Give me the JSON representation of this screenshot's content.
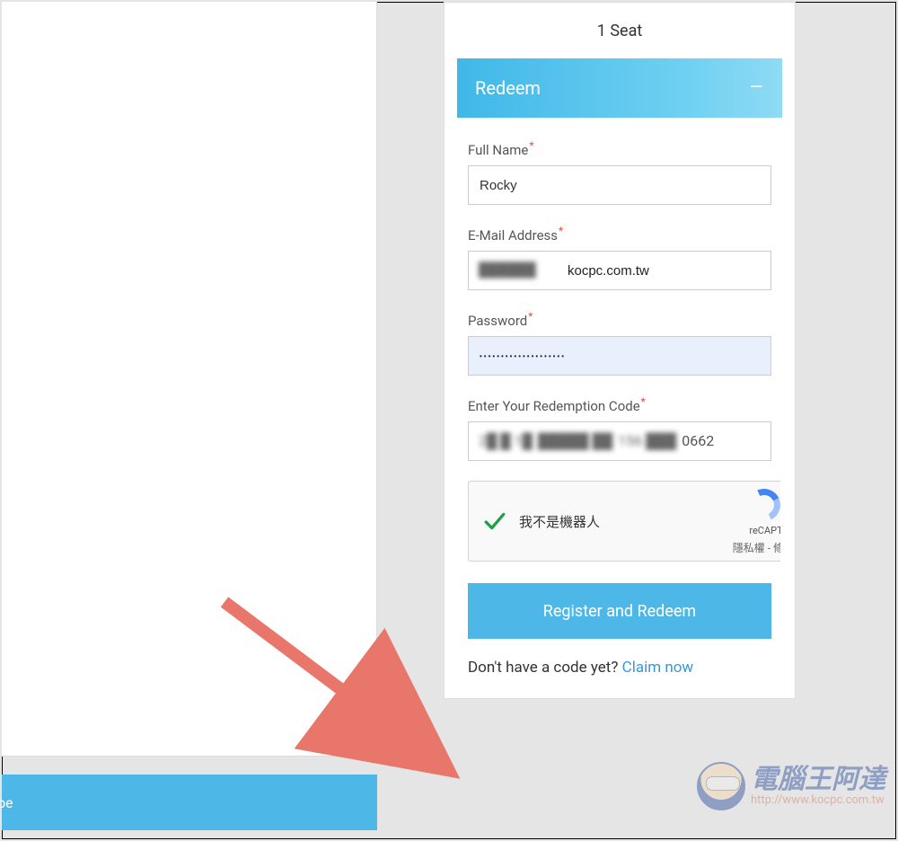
{
  "left": {
    "subscribe_label": "oscribe"
  },
  "card": {
    "seat_text": "1 Seat",
    "redeem_title": "Redeem",
    "fields": {
      "name_label": "Full Name",
      "name_value": "Rocky",
      "email_label": "E-Mail Address",
      "email_value": "kocpc.com.tw",
      "password_label": "Password",
      "password_value": "••••••••••••••••••••",
      "code_label": "Enter Your Redemption Code",
      "code_visible_tail": "0662"
    },
    "captcha": {
      "label": "我不是機器人",
      "brand": "reCAPT",
      "privacy": "隱私權 - 條"
    },
    "submit_label": "Register and Redeem",
    "nocode_text": "Don't have a code yet? ",
    "nocode_link": "Claim now"
  },
  "watermark": {
    "cn": "電腦王阿達",
    "url": "http://www.kocpc.com.tw"
  }
}
